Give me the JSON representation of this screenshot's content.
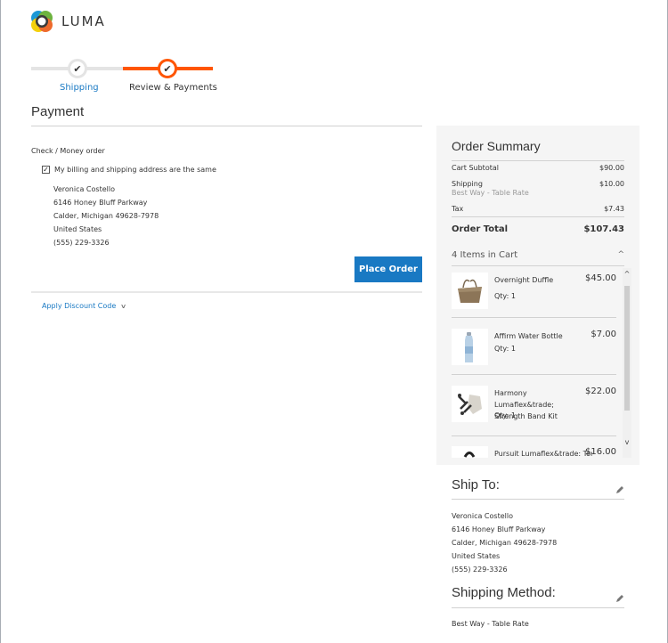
{
  "brand": {
    "name": "LUMA",
    "logo_icon": "luma-logo-icon"
  },
  "progress": {
    "steps": [
      {
        "label": "Shipping",
        "state": "complete",
        "icon": "check-icon"
      },
      {
        "label": "Review & Payments",
        "state": "active",
        "icon": "check-icon"
      }
    ],
    "colors": {
      "active": "#ff5501",
      "inactive": "#e4e4e4",
      "link": "#1979c3"
    }
  },
  "payment": {
    "title": "Payment",
    "method_label": "Check / Money order",
    "same_address_label": "My billing and shipping address are the same",
    "same_address_checked": true,
    "billing_address": [
      "Veronica Costello",
      "6146 Honey Bluff Parkway",
      "Calder, Michigan 49628-7978",
      "United States",
      "(555) 229-3326"
    ],
    "place_order_label": "Place Order",
    "discount_label": "Apply Discount Code",
    "button_color": "#1979c3"
  },
  "summary": {
    "title": "Order Summary",
    "rows": {
      "subtotal": {
        "label": "Cart Subtotal",
        "value": "$90.00"
      },
      "shipping": {
        "label": "Shipping",
        "sub": "Best Way - Table Rate",
        "value": "$10.00"
      },
      "tax": {
        "label": "Tax",
        "value": "$7.43"
      }
    },
    "total": {
      "label": "Order Total",
      "value": "$107.43"
    },
    "cart_toggle_label": "4 Items in Cart",
    "items": [
      {
        "name": "Overnight Duffle",
        "price": "$45.00",
        "qty": "Qty: 1",
        "thumb": "duffle-bag-image"
      },
      {
        "name": "Affirm Water Bottle",
        "price": "$7.00",
        "qty": "Qty: 1",
        "thumb": "water-bottle-image"
      },
      {
        "name": "Harmony Lumaflex&trade; Strength Band Kit",
        "price": "$22.00",
        "qty": "Qty: 1",
        "thumb": "strength-band-image"
      },
      {
        "name": "Pursuit Lumaflex&trade: Tone",
        "price": "$16.00",
        "qty": "",
        "thumb": "tone-band-image"
      }
    ]
  },
  "ship_to": {
    "title": "Ship To:",
    "address": [
      "Veronica Costello",
      "6146 Honey Bluff Parkway",
      "Calder, Michigan 49628-7978",
      "United States",
      "(555) 229-3326"
    ]
  },
  "shipping_method": {
    "title": "Shipping Method:",
    "value": "Best Way - Table Rate"
  }
}
